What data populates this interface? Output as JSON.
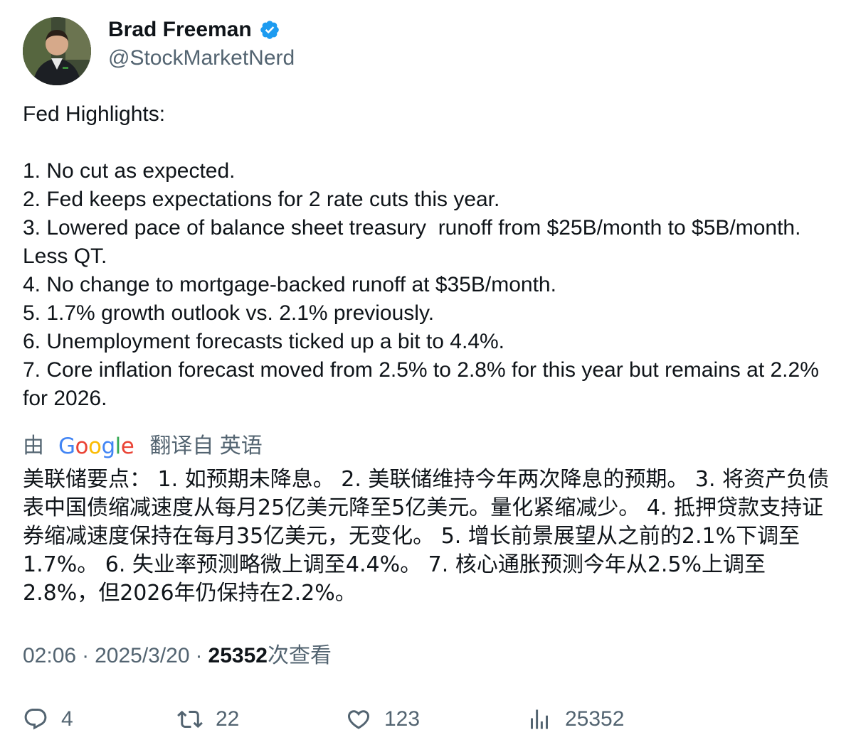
{
  "author": {
    "display_name": "Brad Freeman",
    "handle": "@StockMarketNerd",
    "verified": true,
    "verified_color": "#1d9bf0"
  },
  "tweet": {
    "text": "Fed Highlights:\n\n1. No cut as expected.\n2. Fed keeps expectations for 2 rate cuts this year.\n3. Lowered pace of balance sheet treasury  runoff from $25B/month to $5B/month. Less QT.\n4. No change to mortgage-backed runoff at $35B/month.\n5. 1.7% growth outlook vs. 2.1% previously.\n6. Unemployment forecasts ticked up a bit to 4.4%.\n7. Core inflation forecast moved from 2.5% to 2.8% for this year but remains at 2.2% for 2026."
  },
  "translation": {
    "prefix": "由",
    "provider": "Google",
    "suffix": "翻译自 英语",
    "text": "美联储要点： 1. 如预期未降息。 2. 美联储维持今年两次降息的预期。 3. 将资产负债表中国债缩减速度从每月25亿美元降至5亿美元。量化紧缩减少。 4. 抵押贷款支持证券缩减速度保持在每月35亿美元，无变化。 5. 增长前景展望从之前的2.1%下调至1.7%。 6. 失业率预测略微上调至4.4%。 7. 核心通胀预测今年从2.5%上调至2.8%，但2026年仍保持在2.2%。"
  },
  "meta": {
    "time": "02:06",
    "separator": "·",
    "date": "2025/3/20",
    "views_count": "25352",
    "views_label": "次查看"
  },
  "actions": {
    "reply": {
      "icon": "reply-icon",
      "count": "4"
    },
    "retweet": {
      "icon": "retweet-icon",
      "count": "22"
    },
    "like": {
      "icon": "heart-icon",
      "count": "123"
    },
    "views": {
      "icon": "analytics-icon",
      "count": "25352"
    }
  }
}
